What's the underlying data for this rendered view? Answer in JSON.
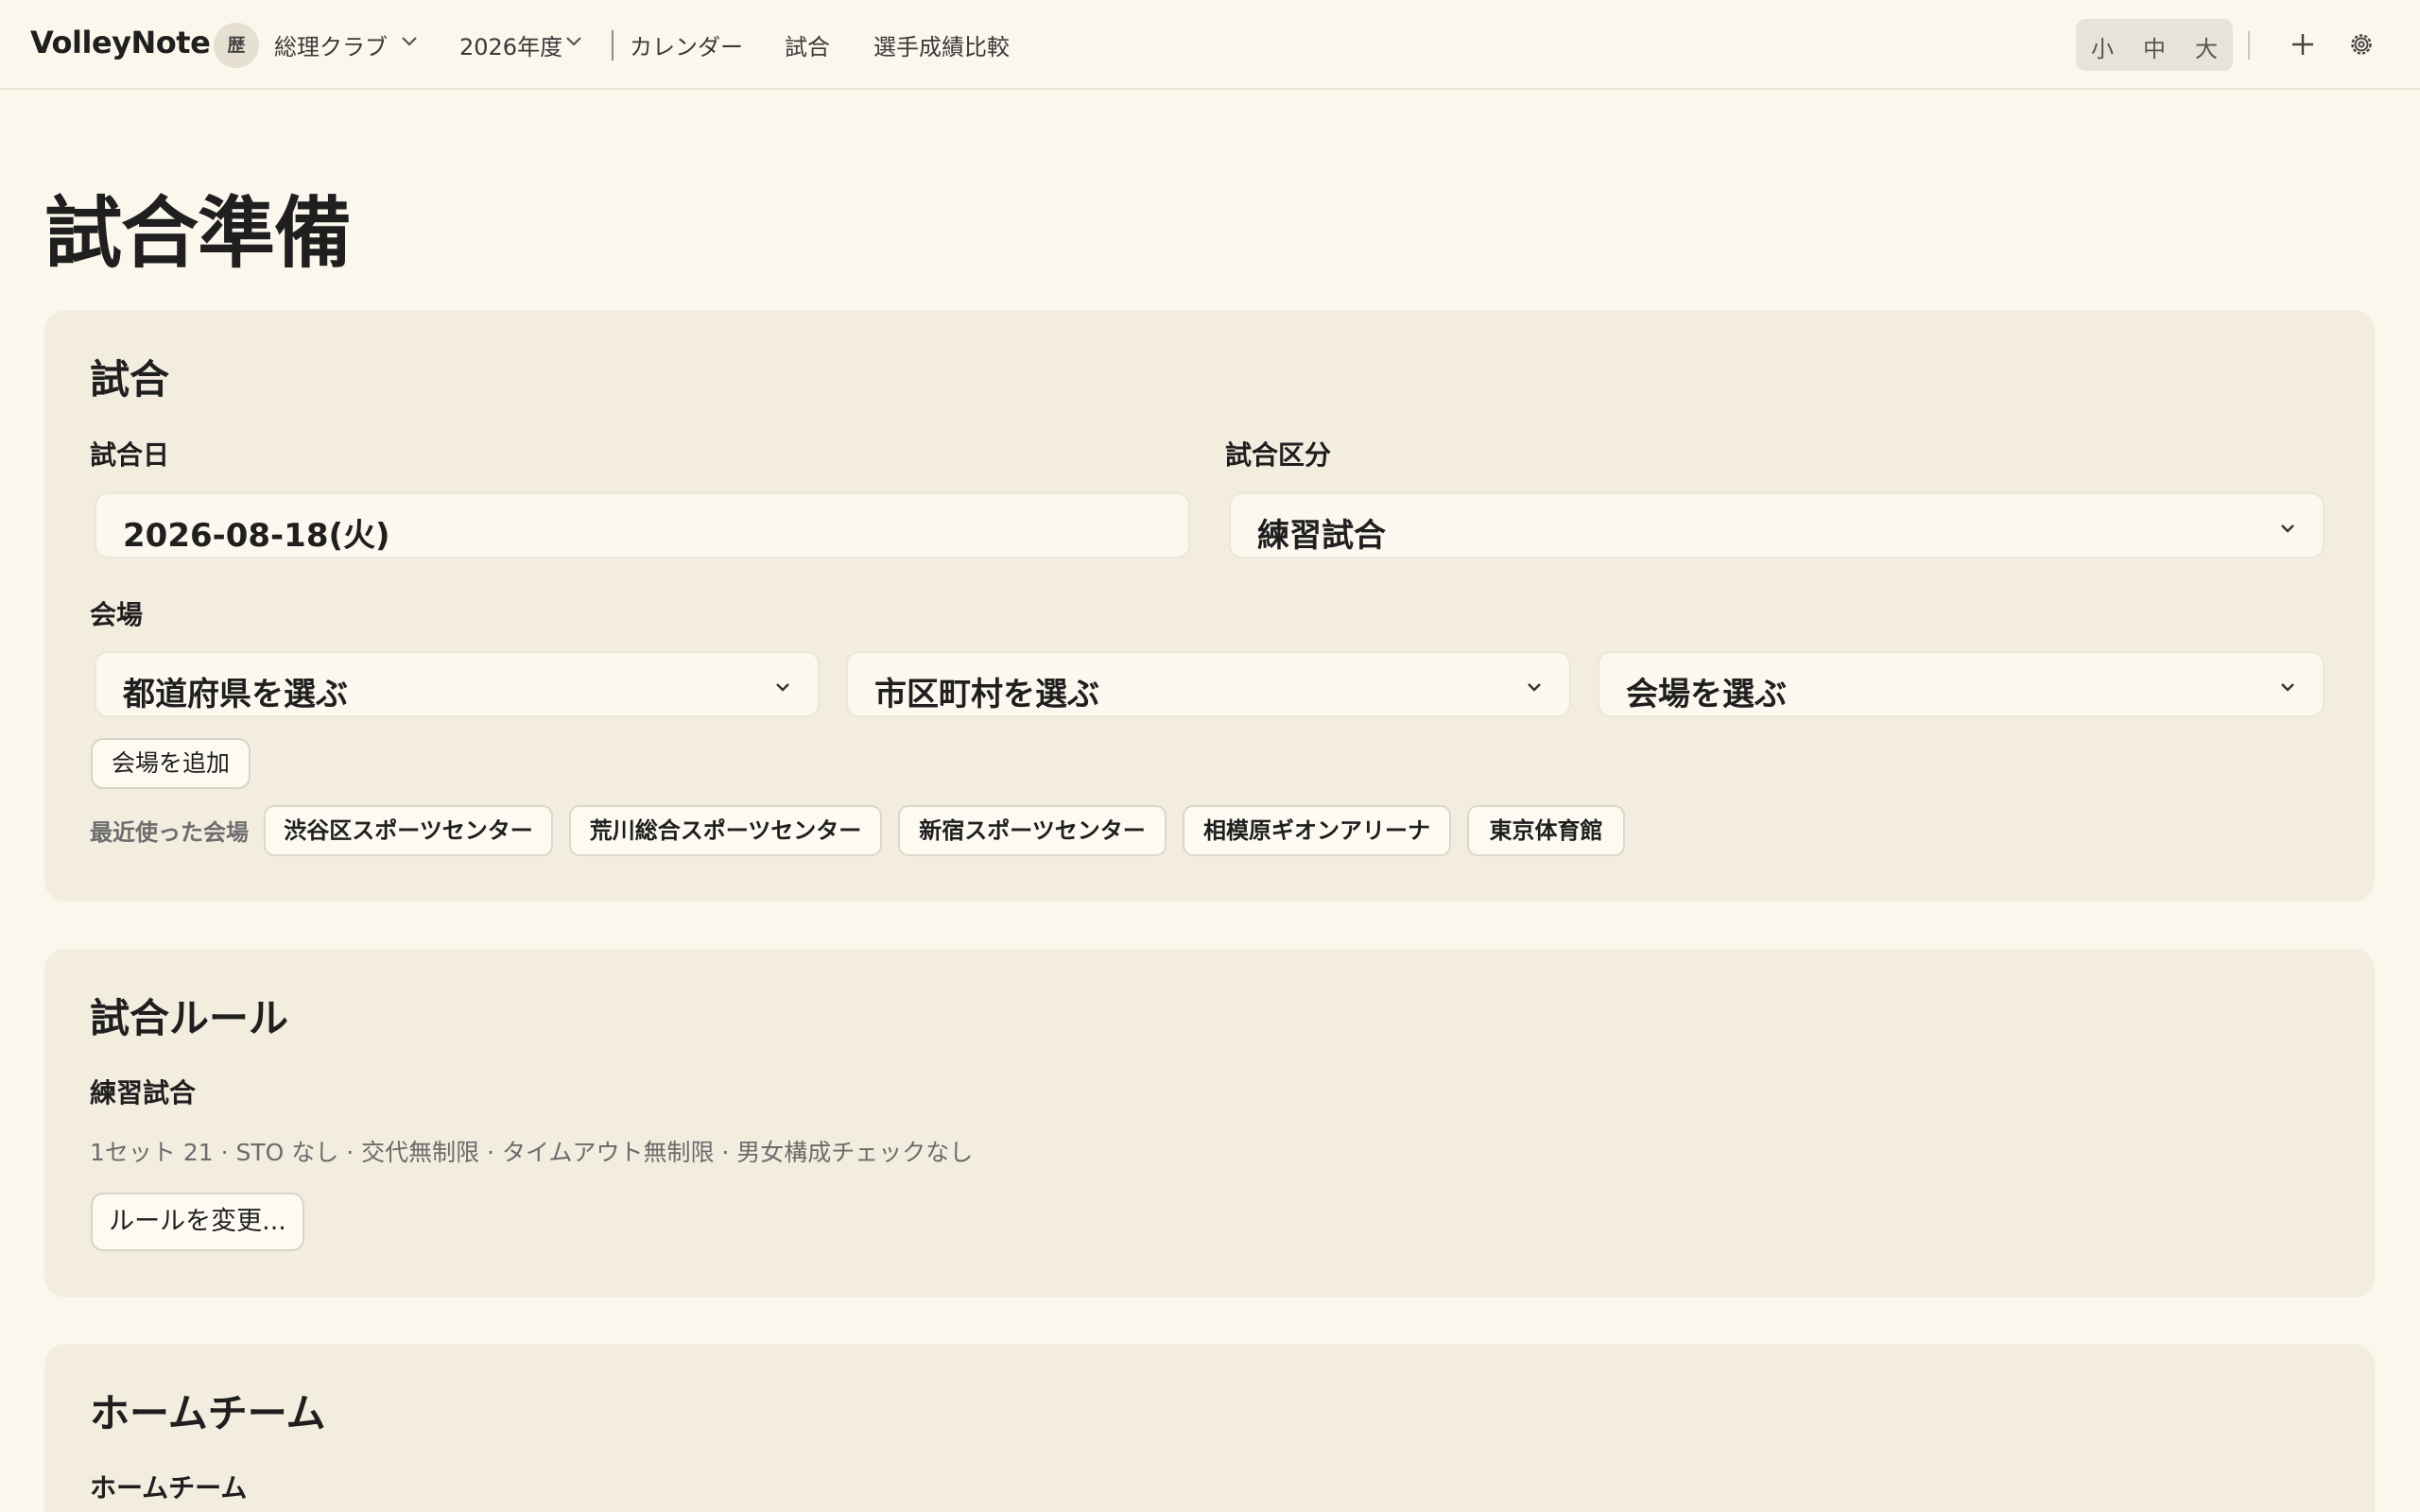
{
  "header": {
    "brand": "VolleyNote",
    "club_badge": "歴",
    "club_name": "総理クラブ",
    "season": "2026年度",
    "nav": [
      "カレンダー",
      "試合",
      "選手成績比較"
    ],
    "font_sizes": [
      "小",
      "中",
      "大"
    ],
    "icons": [
      "chevron-down-icon",
      "plus-icon",
      "gear-icon"
    ]
  },
  "page": {
    "title": "試合準備"
  },
  "match_section": {
    "title": "試合",
    "date_label": "試合日",
    "date_value": "2026-08-18(火)",
    "type_label": "試合区分",
    "type_value": "練習試合",
    "venue_label": "会場",
    "prefecture_placeholder": "都道府県を選ぶ",
    "city_placeholder": "市区町村を選ぶ",
    "venue_placeholder": "会場を選ぶ",
    "add_venue_label": "会場を追加",
    "recent_label": "最近使った会場",
    "recent_venues": [
      "渋谷区スポーツセンター",
      "荒川総合スポーツセンター",
      "新宿スポーツセンター",
      "相模原ギオンアリーナ",
      "東京体育館"
    ]
  },
  "rules_section": {
    "title": "試合ルール",
    "rule_name": "練習試合",
    "rule_summary": "1セット 21 · STO なし · 交代無制限 · タイムアウト無制限 · 男女構成チェックなし",
    "change_label": "ルールを変更..."
  },
  "home_section": {
    "title": "ホームチーム",
    "team_label": "ホームチーム"
  },
  "colors": {
    "background": "#fbf7ec",
    "card": "#f3ede0",
    "input": "#fcf8ef",
    "text": "#1f1f1f",
    "muted": "#6b6b6b"
  }
}
